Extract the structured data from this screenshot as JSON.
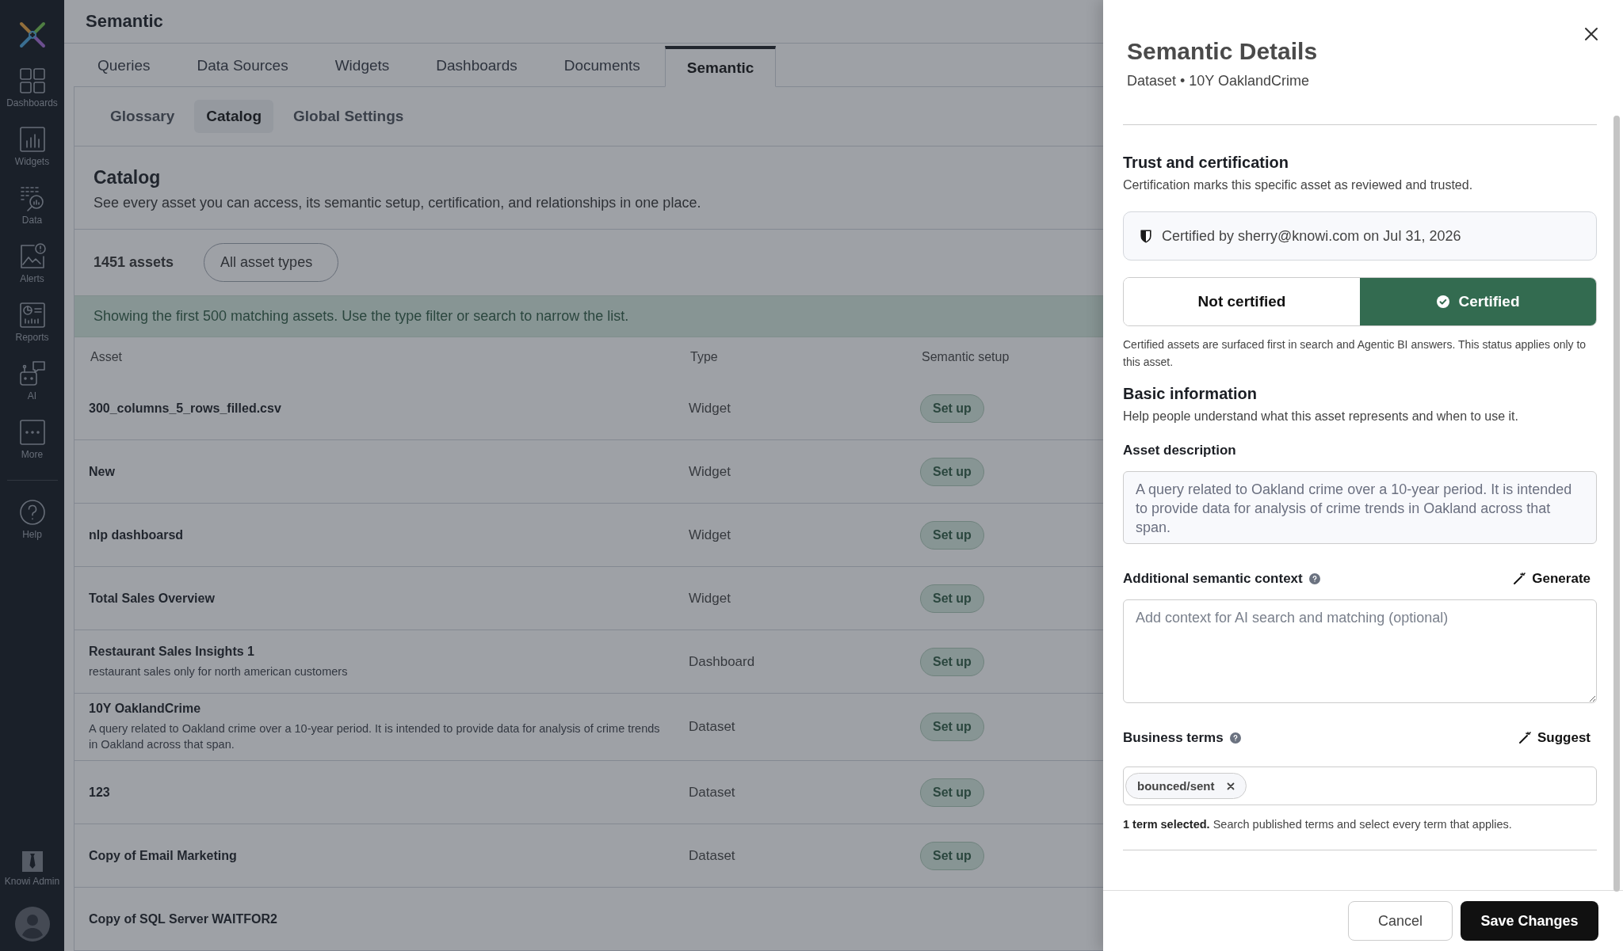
{
  "sidebar": {
    "items": [
      {
        "label": "Dashboards"
      },
      {
        "label": "Widgets"
      },
      {
        "label": "Data"
      },
      {
        "label": "Alerts"
      },
      {
        "label": "Reports"
      },
      {
        "label": "AI"
      },
      {
        "label": "More"
      }
    ],
    "help": {
      "label": "Help"
    },
    "admin": {
      "label": "Knowi Admin"
    }
  },
  "page": {
    "title": "Semantic"
  },
  "tabs": [
    {
      "label": "Queries",
      "selected": false
    },
    {
      "label": "Data Sources",
      "selected": false
    },
    {
      "label": "Widgets",
      "selected": false
    },
    {
      "label": "Dashboards",
      "selected": false
    },
    {
      "label": "Documents",
      "selected": false
    },
    {
      "label": "Semantic",
      "selected": true
    }
  ],
  "subtabs": [
    {
      "label": "Glossary",
      "selected": false
    },
    {
      "label": "Catalog",
      "selected": true
    },
    {
      "label": "Global Settings",
      "selected": false
    }
  ],
  "catalog": {
    "title": "Catalog",
    "description": "See every asset you can access, its semantic setup, certification, and relationships in one place.",
    "count": "1451 assets",
    "filter": "All asset types",
    "banner": "Showing the first 500 matching assets. Use the type filter or search to narrow the list."
  },
  "table": {
    "columns": [
      "Asset",
      "Type",
      "Semantic setup"
    ],
    "rows": [
      {
        "name": "300_columns_5_rows_filled.csv",
        "type": "Widget",
        "action": "Set up"
      },
      {
        "name": "New",
        "type": "Widget",
        "action": "Set up"
      },
      {
        "name": "nlp dashboarsd",
        "type": "Widget",
        "action": "Set up"
      },
      {
        "name": "Total Sales Overview",
        "type": "Widget",
        "action": "Set up"
      },
      {
        "name": "Restaurant Sales Insights 1",
        "description": "restaurant sales only for north american customers",
        "type": "Dashboard",
        "action": "Set up"
      },
      {
        "name": "10Y OaklandCrime",
        "description": "A query related to Oakland crime over a 10-year period. It is intended to provide data for analysis of crime trends in Oakland across that span.",
        "type": "Dataset",
        "action": "Set up"
      },
      {
        "name": "123",
        "type": "Dataset",
        "action": "Set up"
      },
      {
        "name": "Copy of Email Marketing",
        "type": "Dataset",
        "action": "Set up"
      },
      {
        "name": "Copy of SQL Server WAITFOR2"
      }
    ]
  },
  "drawer": {
    "title": "Semantic Details",
    "subtitle": "Dataset • 10Y OaklandCrime",
    "trust": {
      "heading": "Trust and certification",
      "description": "Certification marks this specific asset as reviewed and trusted.",
      "certified_by": "Certified by sherry@knowi.com on Jul 31, 2026",
      "options": [
        {
          "label": "Not certified",
          "selected": false
        },
        {
          "label": "Certified",
          "selected": true
        }
      ],
      "note": "Certified assets are surfaced first in search and Agentic BI answers. This status applies only to this asset."
    },
    "basic": {
      "heading": "Basic information",
      "description": "Help people understand what this asset represents and when to use it.",
      "asset_description": {
        "label": "Asset description",
        "value": "A query related to Oakland crime over a 10-year period. It is intended to provide data for analysis of crime trends in Oakland across that span."
      },
      "context": {
        "label": "Additional semantic context",
        "action": "Generate",
        "placeholder": "Add context for AI search and matching (optional)"
      },
      "terms": {
        "label": "Business terms",
        "action": "Suggest",
        "chips": [
          {
            "label": "bounced/sent"
          }
        ],
        "note": "**1 term selected.** Search published terms and select every term that applies."
      }
    },
    "buttons": {
      "cancel": "Cancel",
      "save": "Save Changes"
    }
  }
}
